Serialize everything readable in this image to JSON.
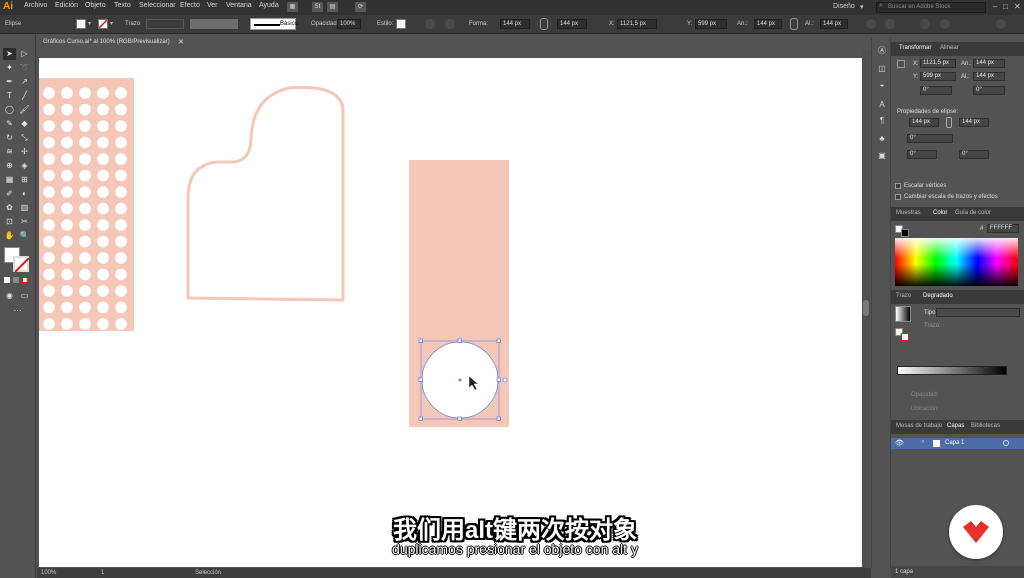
{
  "app": {
    "logo": "Ai"
  },
  "menu": [
    "Archivo",
    "Edición",
    "Objeto",
    "Texto",
    "Seleccionar",
    "Efecto",
    "Ver",
    "Ventana",
    "Ayuda"
  ],
  "menubar_right": {
    "workspace": "Diseño",
    "search_placeholder": "Buscar en Adobe Stock"
  },
  "control": {
    "object_type": "Elipse",
    "stroke_label": "Trazo",
    "stroke_style": "Básico",
    "opacity_label": "Opacidad:",
    "opacity_value": "100%",
    "style_label": "Estilo:",
    "shape_label": "Forma:",
    "width": "144 px",
    "height": "144 px",
    "x": "1121,5 px",
    "y": "599 px",
    "w2": "144 px",
    "h2": "144 px"
  },
  "document": {
    "tab_title": "Gráficos Curso.ai* al 100% (RGB/Previsualizar)",
    "zoom": "100%",
    "artboard": "1",
    "status_tool": "Selección"
  },
  "panels": {
    "transform_tabs": [
      "Transformar",
      "Alinear"
    ],
    "x_label": "X:",
    "x": "1121,5 px",
    "y_label": "Y:",
    "y": "599 px",
    "an_label": "An.:",
    "an": "144 px",
    "al_label": "Al.:",
    "al": "144 px",
    "angle1": "0°",
    "angle2": "0°",
    "ellipse_props_title": "Propiedades de elipse:",
    "ell_w": "144 px",
    "ell_h": "144 px",
    "ell_angle": "0°",
    "pie_start": "0°",
    "pie_end": "0°",
    "scale_corners": "Escalar vértices",
    "scale_strokes": "Cambiar escala de trazos y efectos",
    "color_tabs": [
      "Muestras",
      "Color",
      "Guía de color"
    ],
    "hex_prefix": "#",
    "hex_value": "FFFFFF",
    "gradient_tabs": [
      "Trazo",
      "Degradado"
    ],
    "gradient_type_label": "Tipo:",
    "gradient_trazo_label": "Trazo:",
    "opacity_label": "Opacidad:",
    "location_label": "Ubicación:",
    "layers_tabs": [
      "Mesas de trabajo",
      "Capas",
      "Bibliotecas"
    ],
    "layer_name": "Capa 1",
    "layer_count": "1 capa"
  },
  "subtitles": {
    "chinese": "我们用alt键两次按对象",
    "spanish": "duplicamos presionar el objeto con alt y"
  },
  "colors": {
    "shape_fill": "#f4c7b8",
    "selection": "#6b7fe0",
    "accent": "#ff9a00",
    "brand": "#e4322b"
  },
  "icons": {
    "search": "search-icon",
    "brand": "brand-logo-icon"
  }
}
